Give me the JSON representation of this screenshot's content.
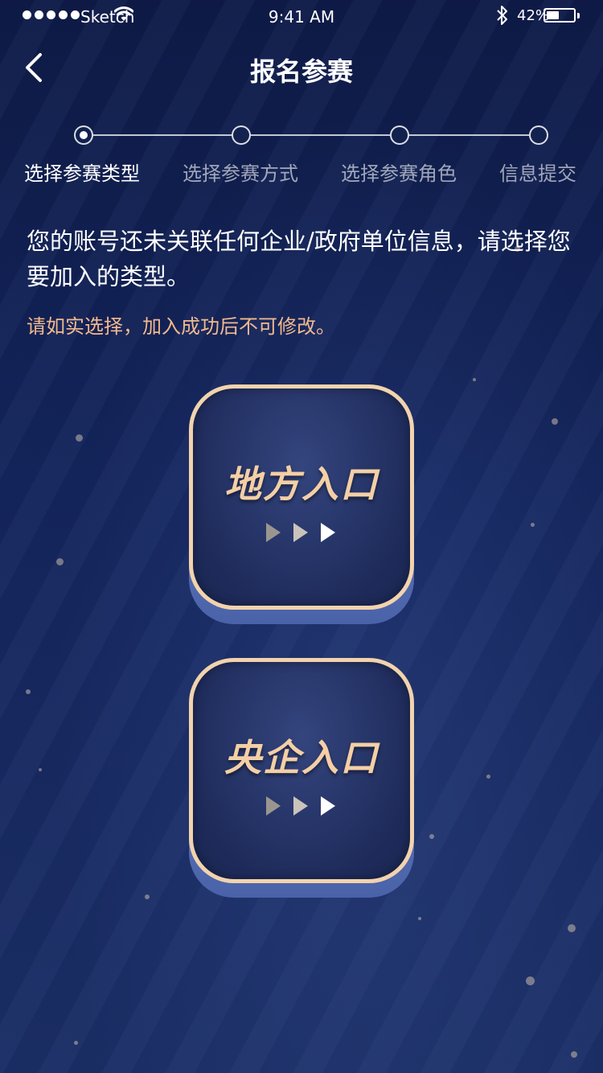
{
  "status_bar": {
    "carrier": "Sketch",
    "time": "9:41 AM",
    "battery": "42%",
    "battery_level": 0.42
  },
  "header": {
    "title": "报名参赛"
  },
  "stepper": {
    "steps": [
      {
        "label": "选择参赛类型",
        "active": true
      },
      {
        "label": "选择参赛方式",
        "active": false
      },
      {
        "label": "选择参赛角色",
        "active": false
      },
      {
        "label": "信息提交",
        "active": false
      }
    ]
  },
  "intro": {
    "text": "您的账号还未关联任何企业/政府单位信息，请选择您要加入的类型。",
    "warning": "请如实选择，加入成功后不可修改。"
  },
  "entries": [
    {
      "label": "地方入口",
      "icon": "triple-arrow-icon"
    },
    {
      "label": "央企入口",
      "icon": "triple-arrow-icon"
    }
  ],
  "colors": {
    "accent": "#f2d3ad",
    "warning": "#f3b98e",
    "background": "#13245a"
  }
}
